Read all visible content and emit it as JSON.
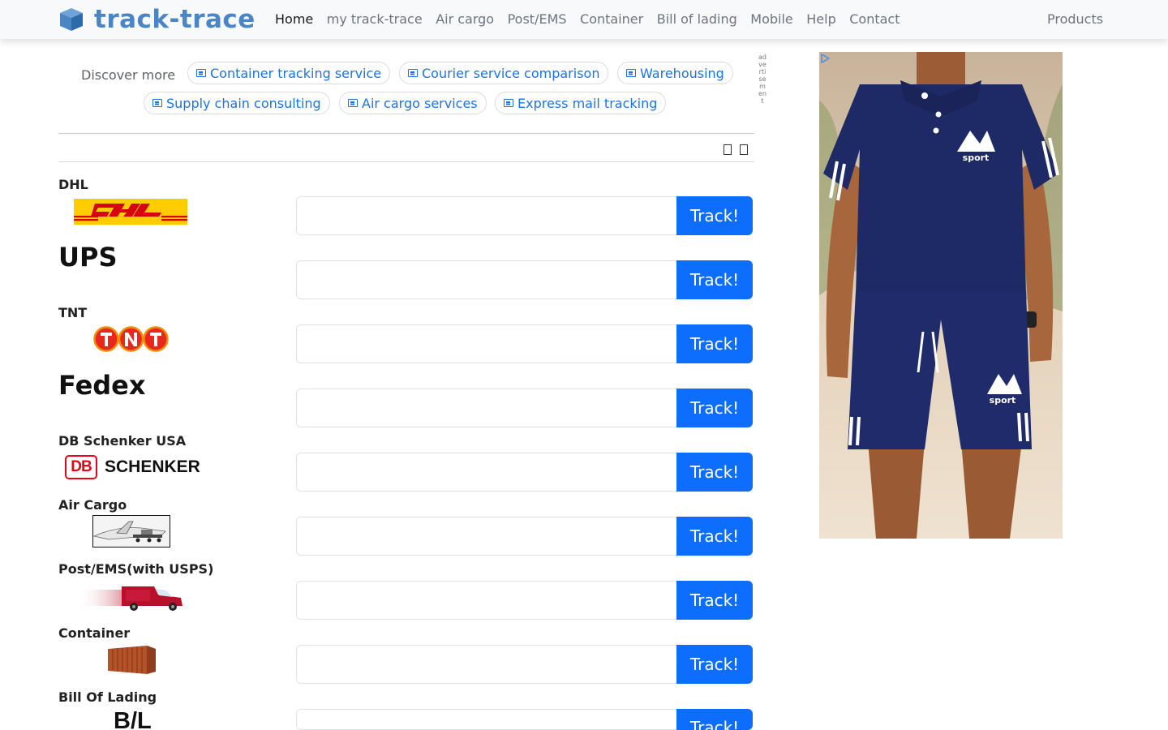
{
  "brand": {
    "name": "track-trace"
  },
  "nav": {
    "links": [
      "Home",
      "my track-trace",
      "Air cargo",
      "Post/EMS",
      "Container",
      "Bill of lading",
      "Mobile",
      "Help",
      "Contact"
    ],
    "right": "Products"
  },
  "discover": {
    "label": "Discover more",
    "chips": [
      "Container tracking service",
      "Courier service comparison",
      "Warehousing",
      "Supply chain consulting",
      "Air cargo services",
      "Express mail tracking"
    ]
  },
  "advertisement_label": "advertisement",
  "carriers": [
    {
      "name": "DHL",
      "logo": "dhl-logo"
    },
    {
      "name": "UPS",
      "logo": "none"
    },
    {
      "name": "TNT",
      "logo": "tnt-logo"
    },
    {
      "name": "Fedex",
      "logo": "none"
    },
    {
      "name": "DB Schenker USA",
      "logo": "db-schenker-logo",
      "logo_text": "SCHENKER",
      "logo_badge": "DB"
    },
    {
      "name": "Air Cargo",
      "logo": "airplane-icon"
    },
    {
      "name": "Post/EMS(with USPS)",
      "logo": "delivery-van-icon"
    },
    {
      "name": "Container",
      "logo": "shipping-container-icon"
    },
    {
      "name": "Bill Of Lading",
      "logo": "bill-of-lading-logo",
      "logo_text": "B/L"
    }
  ],
  "track_button_label": "Track!",
  "ad": {
    "brand_mark": "sport"
  },
  "colors": {
    "primary": "#0d6efd",
    "brand": "#4a86c5",
    "link": "#1a73e8",
    "dhl_yellow": "#ffcc00",
    "dhl_red": "#d40511"
  }
}
